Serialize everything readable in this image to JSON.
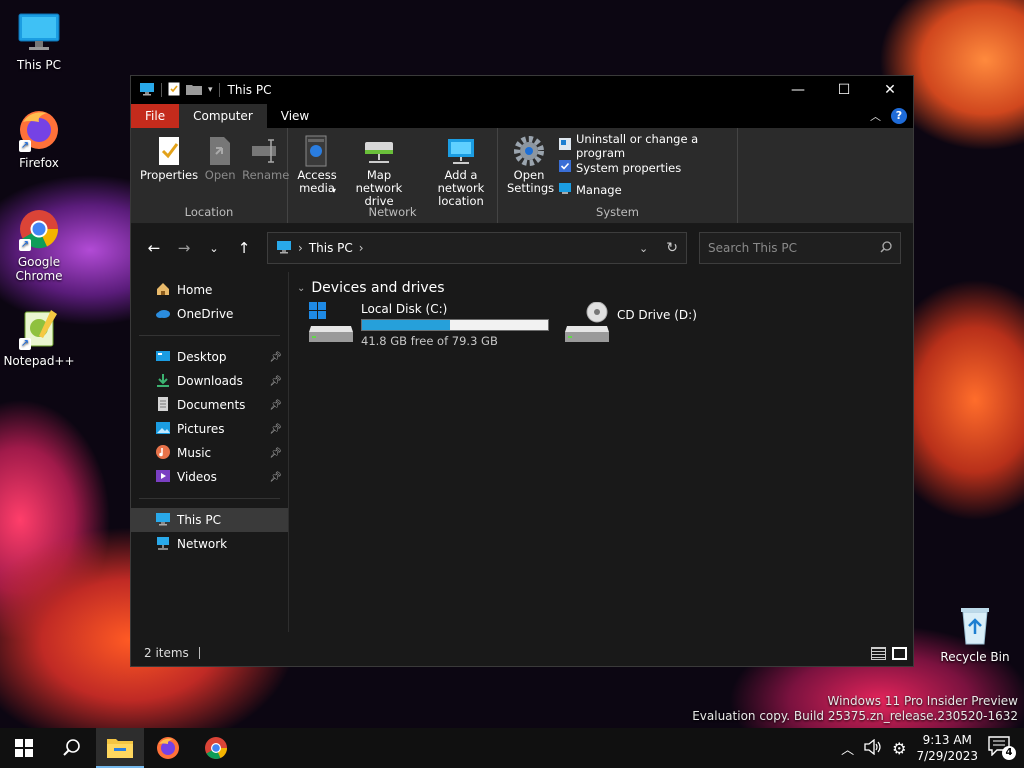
{
  "desktop": {
    "icons": [
      {
        "label": "This PC",
        "icon": "monitor-icon"
      },
      {
        "label": "Firefox",
        "icon": "firefox-icon"
      },
      {
        "label": "Google Chrome",
        "icon": "chrome-icon"
      },
      {
        "label": "Notepad++",
        "icon": "notepad-plus-plus-icon"
      },
      {
        "label": "Recycle Bin",
        "icon": "recycle-bin-icon"
      }
    ],
    "watermark": {
      "line1": "Windows 11 Pro Insider Preview",
      "line2": "Evaluation copy. Build 25375.zn_release.230520-1632"
    }
  },
  "window": {
    "title": "This PC",
    "tabs": [
      "File",
      "Computer",
      "View"
    ],
    "ribbon": {
      "location": {
        "name": "Location",
        "buttons": [
          "Properties",
          "Open",
          "Rename"
        ]
      },
      "network": {
        "name": "Network",
        "access_media": "Access media",
        "map_drive": "Map network drive",
        "add_location": "Add a network location"
      },
      "system": {
        "name": "System",
        "open_settings": "Open Settings",
        "uninstall": "Uninstall or change a program",
        "sys_props": "System properties",
        "manage": "Manage"
      }
    },
    "address": {
      "path": "This PC",
      "search_placeholder": "Search This PC"
    },
    "nav": {
      "top": [
        "Home",
        "OneDrive"
      ],
      "quick": [
        "Desktop",
        "Downloads",
        "Documents",
        "Pictures",
        "Music",
        "Videos"
      ],
      "bottom": [
        "This PC",
        "Network"
      ]
    },
    "content": {
      "group": "Devices and drives",
      "drives": [
        {
          "name": "Local Disk (C:)",
          "free": "41.8 GB free of 79.3 GB",
          "used_fraction": 0.473
        },
        {
          "name": "CD Drive (D:)"
        }
      ]
    },
    "status": {
      "items": "2 items"
    }
  },
  "taskbar": {
    "time": "9:13 AM",
    "date": "7/29/2023",
    "notifications": "4"
  },
  "colors": {
    "accent": "#26a0da",
    "file_tab": "#c42b1c"
  }
}
